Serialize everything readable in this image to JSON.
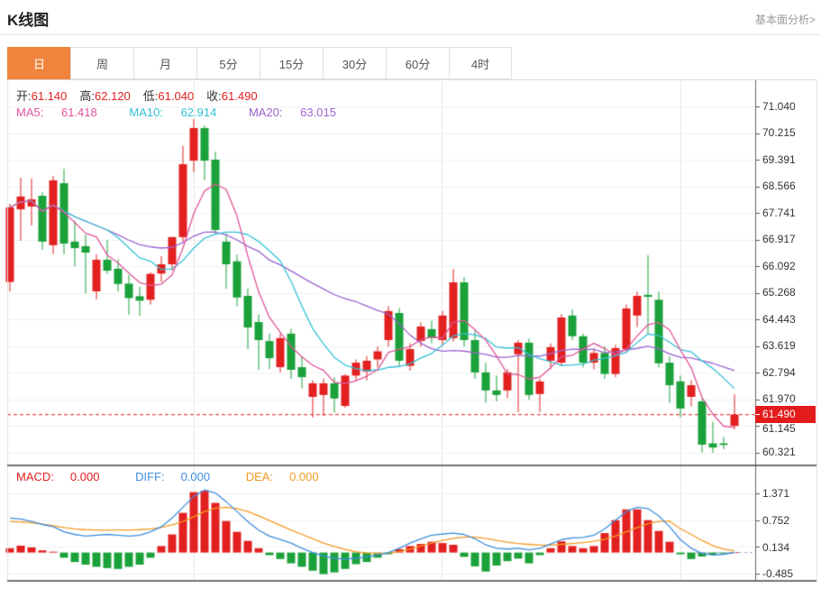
{
  "header": {
    "title": "K线图",
    "link": "基本面分析>"
  },
  "tabs": {
    "items": [
      {
        "label": "日",
        "active": true
      },
      {
        "label": "周",
        "active": false
      },
      {
        "label": "月",
        "active": false
      },
      {
        "label": "5分",
        "active": false
      },
      {
        "label": "15分",
        "active": false
      },
      {
        "label": "30分",
        "active": false
      },
      {
        "label": "60分",
        "active": false
      },
      {
        "label": "4时",
        "active": false
      }
    ]
  },
  "ohlc": {
    "open_label": "开:",
    "open": "61.140",
    "high_label": "高:",
    "high": "62.120",
    "low_label": "低:",
    "low": "61.040",
    "close_label": "收:",
    "close": "61.490"
  },
  "ma": {
    "ma5_label": "MA5:",
    "ma5": "61.418",
    "ma10_label": "MA10:",
    "ma10": "62.914",
    "ma20_label": "MA20:",
    "ma20": "63.015"
  },
  "macd_header": {
    "macd_label": "MACD:",
    "macd": "0.000",
    "diff_label": "DIFF:",
    "diff": "0.000",
    "dea_label": "DEA:",
    "dea": "0.000"
  },
  "price_badge": "61.490",
  "colors": {
    "up": "#e32020",
    "down": "#1ba13a",
    "ma5": "#e0559a",
    "ma10": "#33c1d6",
    "ma20": "#9d62d0",
    "diff_line": "#3e8ede",
    "dea_line": "#f59a23",
    "accent_tab": "#f0843d",
    "badge": "#e31b1b"
  },
  "chart_data": {
    "type": "candlestick+macd",
    "main": {
      "title": "K线图 daily candles",
      "y_ticks": [
        "71.040",
        "70.215",
        "69.391",
        "68.566",
        "67.741",
        "66.917",
        "66.092",
        "65.268",
        "64.443",
        "63.619",
        "62.794",
        "61.970",
        "61.145",
        "60.321"
      ],
      "y_range": [
        60.321,
        71.04
      ],
      "last_price": 61.49,
      "candles_ohlc": [
        [
          65.6,
          68.02,
          65.31,
          67.91
        ],
        [
          67.85,
          68.83,
          66.88,
          68.25
        ],
        [
          67.94,
          68.8,
          67.35,
          68.16
        ],
        [
          68.27,
          68.38,
          66.6,
          66.85
        ],
        [
          66.74,
          68.89,
          66.46,
          68.75
        ],
        [
          68.66,
          69.11,
          66.46,
          66.79
        ],
        [
          66.85,
          67.49,
          66.09,
          66.65
        ],
        [
          66.71,
          67.07,
          65.25,
          66.51
        ],
        [
          65.31,
          66.46,
          65.06,
          66.29
        ],
        [
          66.29,
          66.9,
          65.85,
          65.95
        ],
        [
          66.01,
          66.3,
          65.31,
          65.54
        ],
        [
          65.55,
          65.82,
          64.58,
          65.1
        ],
        [
          65.16,
          65.45,
          64.55,
          65.02
        ],
        [
          65.05,
          65.9,
          64.9,
          65.85
        ],
        [
          65.86,
          66.4,
          65.6,
          66.15
        ],
        [
          66.15,
          67.0,
          65.95,
          66.99
        ],
        [
          66.99,
          69.82,
          66.85,
          69.25
        ],
        [
          69.36,
          70.65,
          69.0,
          70.37
        ],
        [
          70.37,
          70.45,
          68.75,
          69.36
        ],
        [
          69.39,
          69.64,
          67.1,
          67.21
        ],
        [
          66.85,
          67.1,
          65.39,
          66.15
        ],
        [
          66.24,
          66.45,
          64.85,
          65.12
        ],
        [
          65.17,
          65.4,
          63.52,
          64.19
        ],
        [
          64.36,
          64.6,
          62.88,
          63.8
        ],
        [
          63.77,
          64.0,
          62.9,
          63.24
        ],
        [
          62.96,
          64.0,
          62.8,
          63.86
        ],
        [
          64.0,
          64.15,
          62.6,
          62.88
        ],
        [
          62.96,
          63.3,
          62.3,
          62.65
        ],
        [
          62.04,
          62.55,
          61.4,
          62.46
        ],
        [
          62.1,
          62.6,
          61.45,
          62.46
        ],
        [
          62.46,
          62.65,
          61.55,
          61.99
        ],
        [
          61.76,
          62.74,
          61.7,
          62.7
        ],
        [
          62.7,
          63.2,
          62.55,
          63.1
        ],
        [
          62.82,
          63.3,
          62.55,
          63.16
        ],
        [
          63.2,
          63.6,
          62.95,
          63.45
        ],
        [
          63.8,
          64.85,
          63.6,
          64.7
        ],
        [
          64.64,
          64.8,
          63.0,
          63.16
        ],
        [
          63.0,
          63.7,
          62.85,
          63.52
        ],
        [
          63.77,
          64.35,
          63.6,
          64.22
        ],
        [
          64.14,
          64.4,
          63.7,
          63.86
        ],
        [
          63.8,
          64.7,
          63.65,
          64.56
        ],
        [
          63.86,
          66.0,
          63.75,
          65.59
        ],
        [
          65.59,
          65.75,
          63.6,
          63.8
        ],
        [
          63.8,
          64.1,
          62.6,
          62.8
        ],
        [
          62.8,
          63.1,
          61.85,
          62.24
        ],
        [
          62.24,
          62.7,
          61.9,
          62.1
        ],
        [
          62.24,
          62.9,
          62.0,
          62.8
        ],
        [
          63.36,
          63.8,
          61.57,
          63.72
        ],
        [
          63.72,
          63.85,
          61.95,
          62.1
        ],
        [
          62.13,
          62.6,
          61.57,
          62.52
        ],
        [
          63.16,
          63.7,
          62.9,
          63.58
        ],
        [
          63.1,
          64.6,
          63.0,
          64.5
        ],
        [
          64.56,
          64.75,
          63.8,
          63.92
        ],
        [
          63.92,
          64.0,
          62.95,
          63.1
        ],
        [
          63.1,
          63.55,
          62.9,
          63.4
        ],
        [
          63.4,
          63.6,
          62.6,
          62.75
        ],
        [
          62.75,
          63.65,
          62.65,
          63.55
        ],
        [
          63.52,
          64.9,
          63.4,
          64.78
        ],
        [
          64.56,
          65.3,
          64.2,
          65.17
        ],
        [
          65.2,
          66.43,
          64.01,
          65.14
        ],
        [
          65.05,
          65.3,
          62.95,
          63.08
        ],
        [
          63.1,
          63.3,
          61.85,
          62.4
        ],
        [
          62.52,
          62.7,
          61.4,
          61.68
        ],
        [
          62.04,
          62.55,
          61.75,
          62.4
        ],
        [
          61.9,
          62.0,
          60.31,
          60.56
        ],
        [
          60.6,
          61.26,
          60.31,
          60.47
        ],
        [
          60.6,
          60.8,
          60.42,
          60.55
        ],
        [
          61.14,
          62.12,
          61.04,
          61.49
        ]
      ],
      "ma_windows": [
        5,
        10,
        20
      ]
    },
    "macd": {
      "y_ticks": [
        "1.371",
        "0.752",
        "0.134",
        "-0.485"
      ],
      "y_range": [
        -0.485,
        1.371
      ],
      "hist": [
        0.1,
        0.16,
        0.12,
        0.05,
        0.02,
        -0.12,
        -0.22,
        -0.28,
        -0.33,
        -0.36,
        -0.38,
        -0.33,
        -0.28,
        -0.12,
        0.15,
        0.42,
        0.92,
        1.4,
        1.43,
        1.15,
        0.73,
        0.48,
        0.27,
        0.1,
        -0.06,
        -0.15,
        -0.25,
        -0.33,
        -0.42,
        -0.5,
        -0.46,
        -0.38,
        -0.27,
        -0.22,
        -0.12,
        -0.04,
        0.08,
        0.15,
        0.2,
        0.25,
        0.22,
        0.18,
        -0.1,
        -0.32,
        -0.44,
        -0.3,
        -0.2,
        -0.14,
        -0.25,
        -0.06,
        0.1,
        0.26,
        0.15,
        0.1,
        0.15,
        0.45,
        0.75,
        1.0,
        1.0,
        0.75,
        0.5,
        0.25,
        -0.04,
        -0.15,
        -0.09,
        -0.05,
        -0.02,
        0.01
      ],
      "diff": [
        0.8,
        0.78,
        0.72,
        0.65,
        0.6,
        0.48,
        0.42,
        0.38,
        0.4,
        0.42,
        0.4,
        0.38,
        0.4,
        0.48,
        0.6,
        0.8,
        1.05,
        1.3,
        1.45,
        1.38,
        1.18,
        0.95,
        0.72,
        0.52,
        0.38,
        0.3,
        0.22,
        0.1,
        0.0,
        -0.08,
        -0.13,
        -0.15,
        -0.13,
        -0.1,
        -0.06,
        0.0,
        0.1,
        0.22,
        0.32,
        0.4,
        0.43,
        0.45,
        0.42,
        0.32,
        0.18,
        0.1,
        0.08,
        0.1,
        0.06,
        0.1,
        0.2,
        0.3,
        0.34,
        0.35,
        0.4,
        0.55,
        0.75,
        0.95,
        1.05,
        1.02,
        0.85,
        0.6,
        0.3,
        0.1,
        -0.02,
        -0.06,
        -0.04,
        0.0
      ],
      "dea": [
        0.72,
        0.71,
        0.69,
        0.66,
        0.62,
        0.58,
        0.55,
        0.53,
        0.52,
        0.52,
        0.52,
        0.52,
        0.53,
        0.55,
        0.58,
        0.64,
        0.72,
        0.83,
        0.95,
        1.03,
        1.05,
        1.02,
        0.95,
        0.85,
        0.74,
        0.63,
        0.52,
        0.42,
        0.32,
        0.22,
        0.14,
        0.07,
        0.02,
        -0.01,
        -0.02,
        -0.01,
        0.02,
        0.08,
        0.15,
        0.22,
        0.28,
        0.33,
        0.36,
        0.36,
        0.33,
        0.28,
        0.24,
        0.21,
        0.19,
        0.17,
        0.17,
        0.19,
        0.21,
        0.23,
        0.26,
        0.31,
        0.38,
        0.48,
        0.58,
        0.67,
        0.72,
        0.73,
        0.55,
        0.42,
        0.28,
        0.16,
        0.08,
        0.04
      ]
    }
  }
}
